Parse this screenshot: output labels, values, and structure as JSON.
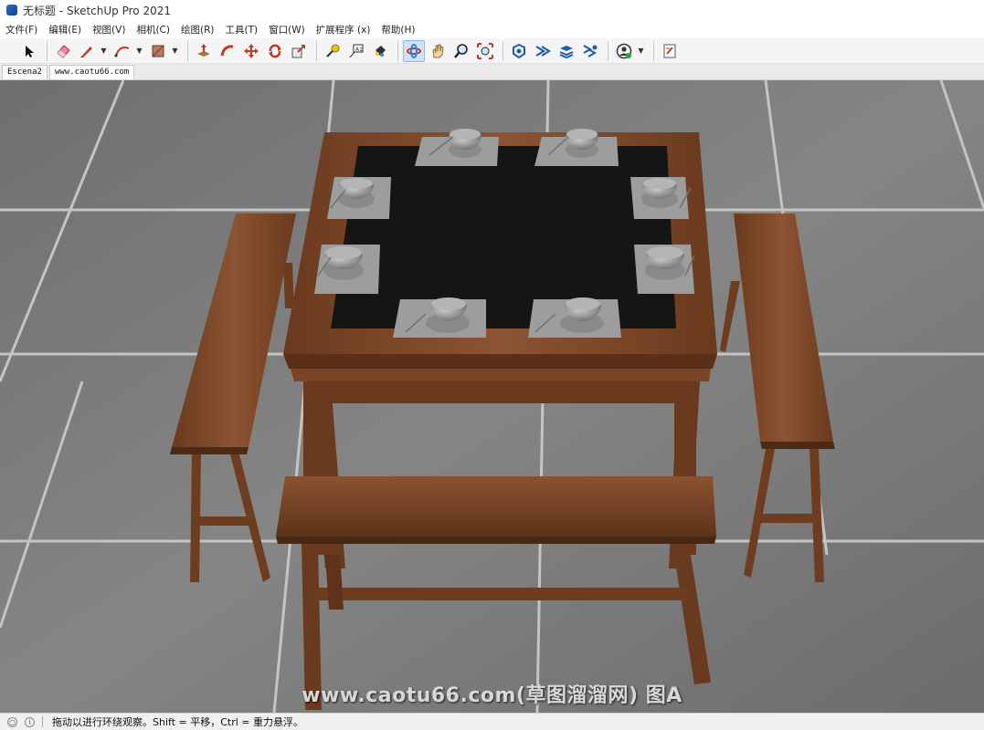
{
  "window": {
    "title": "无标题 - SketchUp Pro 2021",
    "app_icon": "sketchup-logo-icon"
  },
  "menu": [
    {
      "label": "文件(F)"
    },
    {
      "label": "编辑(E)"
    },
    {
      "label": "视图(V)"
    },
    {
      "label": "相机(C)"
    },
    {
      "label": "绘图(R)"
    },
    {
      "label": "工具(T)"
    },
    {
      "label": "窗口(W)"
    },
    {
      "label": "扩展程序 (x)"
    },
    {
      "label": "帮助(H)"
    }
  ],
  "toolbar": {
    "tools": [
      "select-arrow-icon",
      "eraser-icon",
      "pencil-line-icon",
      "arc-icon",
      "rectangle-shape-icon",
      "push-pull-icon",
      "follow-me-icon",
      "move-icon",
      "rotate-icon",
      "scale-icon",
      "tape-measure-icon",
      "text-icon",
      "paint-bucket-icon",
      "orbit-icon",
      "pan-icon",
      "zoom-icon",
      "zoom-extents-icon",
      "3d-warehouse-icon",
      "extension-warehouse-icon",
      "layout-icon",
      "extension-manager-icon",
      "profile-account-icon",
      "send-to-layout-icon"
    ],
    "active_tool": "orbit-icon"
  },
  "scenes": {
    "tabs": [
      {
        "label": "Escena2"
      },
      {
        "label": "www.caotu66.com"
      }
    ],
    "current_index": 1
  },
  "viewport": {
    "watermark": "www.caotu66.com(草图溜溜网) 图A",
    "colors": {
      "floor": "#7b7b7b",
      "floor_lines": "#bdbdbd",
      "wood": "#7a4424",
      "wood_light": "#8f5633",
      "tablecloth": "#131313",
      "placemat": "#9c9c9c",
      "bowl": "#a3a3a3"
    }
  },
  "statusbar": {
    "text": "拖动以进行环绕观察。Shift = 平移，Ctrl = 重力悬浮。",
    "icons": [
      "geolocation-icon",
      "info-icon"
    ]
  }
}
